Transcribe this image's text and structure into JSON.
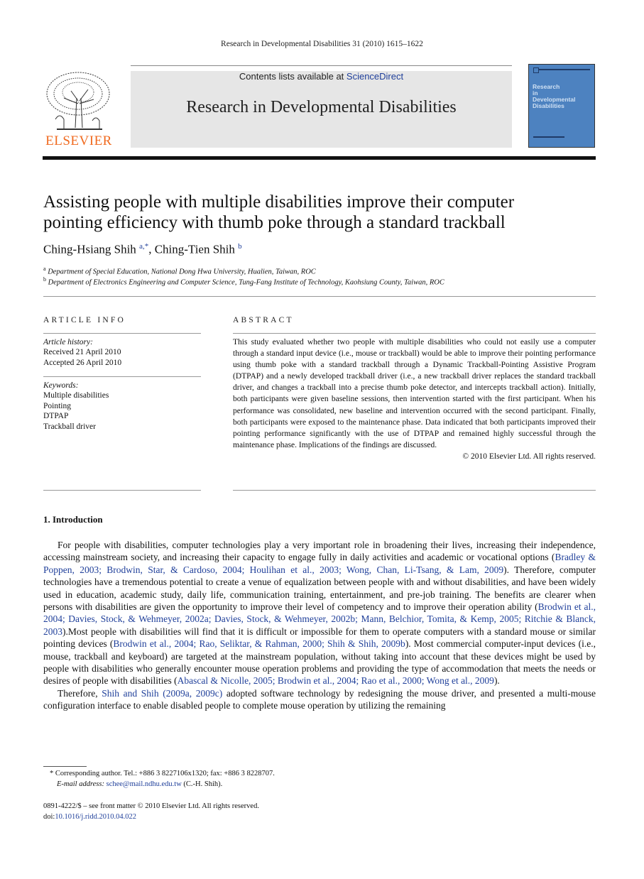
{
  "running_head": "Research in Developmental Disabilities 31 (2010) 1615–1622",
  "header": {
    "publisher_logo_text": "ELSEVIER",
    "contents_prefix": "Contents lists available at ",
    "contents_link": "ScienceDirect",
    "journal_title": "Research in Developmental Disabilities",
    "cover_title_lines": [
      "Research",
      "in",
      "Developmental",
      "Disabilities"
    ]
  },
  "article": {
    "title_line1": "Assisting people with multiple disabilities improve their computer",
    "title_line2": "pointing efficiency with thumb poke through a standard trackball",
    "authors": [
      {
        "name": "Ching-Hsiang Shih",
        "sup": "a,*"
      },
      {
        "name": "Ching-Tien Shih",
        "sup": "b"
      }
    ],
    "author_separator": ", ",
    "affiliations": [
      {
        "sup": "a",
        "text": "Department of Special Education, National Dong Hwa University, Hualien, Taiwan, ROC"
      },
      {
        "sup": "b",
        "text": "Department of Electronics Engineering and Computer Science, Tung-Fang Institute of Technology, Kaohsiung County, Taiwan, ROC"
      }
    ]
  },
  "article_info": {
    "heading": "ARTICLE INFO",
    "history_label": "Article history:",
    "received": "Received 21 April 2010",
    "accepted": "Accepted 26 April 2010",
    "keywords_label": "Keywords:",
    "keywords": [
      "Multiple disabilities",
      "Pointing",
      "DTPAP",
      "Trackball driver"
    ]
  },
  "abstract": {
    "heading": "ABSTRACT",
    "text": "This study evaluated whether two people with multiple disabilities who could not easily use a computer through a standard input device (i.e., mouse or trackball) would be able to improve their pointing performance using thumb poke with a standard trackball through a Dynamic Trackball-Pointing Assistive Program (DTPAP) and a newly developed trackball driver (i.e., a new trackball driver replaces the standard trackball driver, and changes a trackball into a precise thumb poke detector, and intercepts trackball action). Initially, both participants were given baseline sessions, then intervention started with the first participant. When his performance was consolidated, new baseline and intervention occurred with the second participant. Finally, both participants were exposed to the maintenance phase. Data indicated that both participants improved their pointing performance significantly with the use of DTPAP and remained highly successful through the maintenance phase. Implications of the findings are discussed.",
    "copyright": "© 2010 Elsevier Ltd. All rights reserved."
  },
  "intro": {
    "heading": "1.  Introduction",
    "p1": [
      {
        "t": "For people with disabilities, computer technologies play a very important role in broadening their lives, increasing their independence, accessing mainstream society, and increasing their capacity to engage fully in daily activities and academic or vocational options ("
      },
      {
        "l": "Bradley & Poppen, 2003; Brodwin, Star, & Cardoso, 2004; Houlihan et al., 2003; Wong, Chan, Li-Tsang, & Lam, 2009"
      },
      {
        "t": "). Therefore, computer technologies have a tremendous potential to create a venue of equalization between people with and without disabilities, and have been widely used in education, academic study, daily life, communication training, entertainment, and pre-job training. The benefits are clearer when persons with disabilities are given the opportunity to improve their level of competency and to improve their operation ability ("
      },
      {
        "l": "Brodwin et al., 2004; Davies, Stock, & Wehmeyer, 2002a; Davies, Stock, & Wehmeyer, 2002b; Mann, Belchior, Tomita, & Kemp, 2005; Ritchie & Blanck, 2003"
      },
      {
        "t": ").Most people with disabilities will find that it is difficult or impossible for them to operate computers with a standard mouse or similar pointing devices ("
      },
      {
        "l": "Brodwin et al., 2004; Rao, Seliktar, & Rahman, 2000; Shih & Shih, 2009b"
      },
      {
        "t": "). Most commercial computer-input devices (i.e., mouse, trackball and keyboard) are targeted at the mainstream population, without taking into account that these devices might be used by people with disabilities who generally encounter mouse operation problems and providing the type of accommodation that meets the needs or desires of people with disabilities ("
      },
      {
        "l": "Abascal & Nicolle, 2005; Brodwin et al., 2004; Rao et al., 2000; Wong et al., 2009"
      },
      {
        "t": ")."
      }
    ],
    "p2": [
      {
        "t": "Therefore, "
      },
      {
        "l": "Shih and Shih (2009a, 2009c)"
      },
      {
        "t": " adopted software technology by redesigning the mouse driver, and presented a multi-mouse configuration interface to enable disabled people to complete mouse operation by utilizing the remaining"
      }
    ]
  },
  "footnotes": {
    "corresponding": "*  Corresponding author. Tel.: +886 3 8227106x1320; fax: +886 3 8228707.",
    "email_label": "E-mail address: ",
    "email": "schee@mail.ndhu.edu.tw",
    "email_suffix": " (C.-H. Shih)."
  },
  "bottom": {
    "issn": "0891-4222/$ – see front matter © 2010 Elsevier Ltd. All rights reserved.",
    "doi_label": "doi:",
    "doi": "10.1016/j.ridd.2010.04.022"
  }
}
